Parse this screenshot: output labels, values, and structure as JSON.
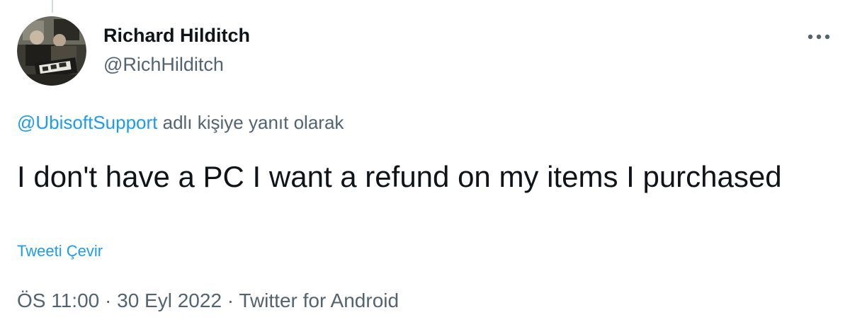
{
  "tweet": {
    "author": {
      "display_name": "Richard Hilditch",
      "handle": "@RichHilditch"
    },
    "reply_context": {
      "mention": "@UbisoftSupport",
      "suffix": " adlı kişiye yanıt olarak"
    },
    "text": "I don't have a PC I want a refund on my items I purchased",
    "translate_label": "Tweeti Çevir",
    "meta": {
      "time": "ÖS 11:00",
      "separator": " · ",
      "date": "30 Eyl 2022",
      "source": "Twitter for Android"
    }
  },
  "icons": {
    "more": "more-horizontal-icon",
    "avatar": "profile-photo"
  },
  "colors": {
    "accent": "#1d9bf0",
    "secondary_text": "#536471",
    "primary_text": "#0f1419",
    "thread_line": "#cfd9de"
  }
}
